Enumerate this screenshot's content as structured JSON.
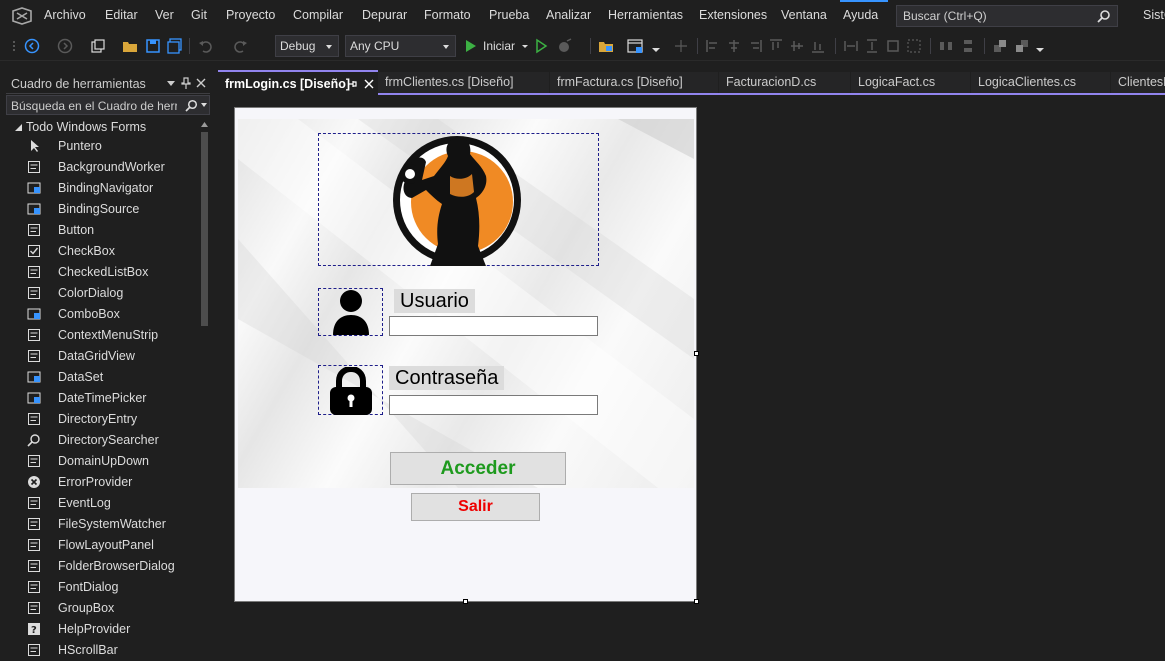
{
  "menu": {
    "items": [
      "Archivo",
      "Editar",
      "Ver",
      "Git",
      "Proyecto",
      "Compilar",
      "Depurar",
      "Formato",
      "Prueba",
      "Analizar",
      "Herramientas",
      "Extensiones",
      "Ventana",
      "Ayuda"
    ],
    "search_placeholder": "Buscar (Ctrl+Q)",
    "solution_name": "SistC"
  },
  "toolbar": {
    "configuration": "Debug",
    "platform": "Any CPU",
    "start_label": "Iniciar"
  },
  "toolbox": {
    "title": "Cuadro de herramientas",
    "search_placeholder": "Búsqueda en el Cuadro de herra",
    "group": "Todo Windows Forms",
    "items": [
      "Puntero",
      "BackgroundWorker",
      "BindingNavigator",
      "BindingSource",
      "Button",
      "CheckBox",
      "CheckedListBox",
      "ColorDialog",
      "ComboBox",
      "ContextMenuStrip",
      "DataGridView",
      "DataSet",
      "DateTimePicker",
      "DirectoryEntry",
      "DirectorySearcher",
      "DomainUpDown",
      "ErrorProvider",
      "EventLog",
      "FileSystemWatcher",
      "FlowLayoutPanel",
      "FolderBrowserDialog",
      "FontDialog",
      "GroupBox",
      "HelpProvider",
      "HScrollBar"
    ]
  },
  "tabs": [
    {
      "label": "frmLogin.cs [Diseño]",
      "active": true
    },
    {
      "label": "frmClientes.cs [Diseño]",
      "active": false
    },
    {
      "label": "frmFactura.cs [Diseño]",
      "active": false
    },
    {
      "label": "FacturacionD.cs",
      "active": false
    },
    {
      "label": "LogicaFact.cs",
      "active": false
    },
    {
      "label": "LogicaClientes.cs",
      "active": false
    },
    {
      "label": "ClientesD",
      "active": false
    }
  ],
  "form": {
    "usuario_label": "Usuario",
    "contrasena_label": "Contraseña",
    "acceder_label": "Acceder",
    "salir_label": "Salir",
    "colors": {
      "acceder": "#1e9a1e",
      "salir": "#ee0000",
      "accent": "#f08a24"
    }
  }
}
